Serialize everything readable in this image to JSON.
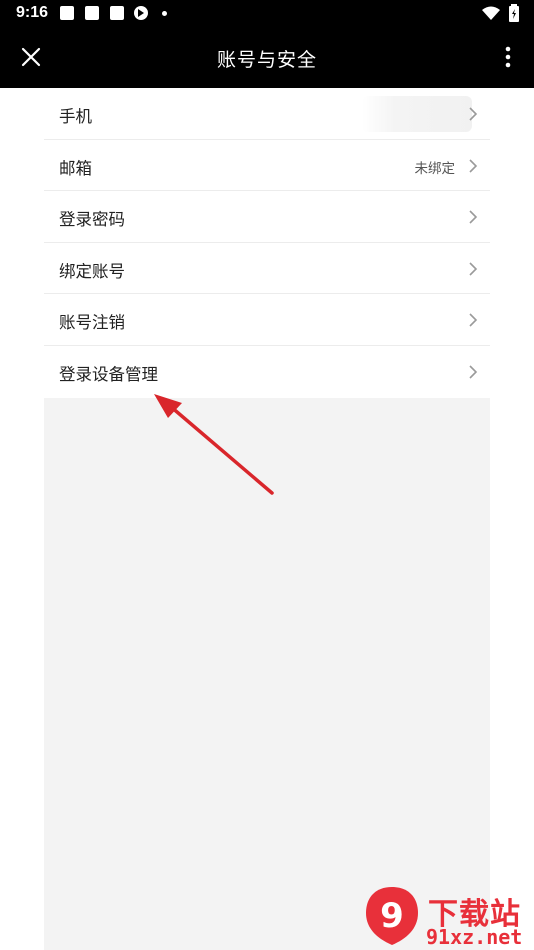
{
  "status_bar": {
    "time": "9:16"
  },
  "header": {
    "title": "账号与安全",
    "close_icon": "close-icon",
    "more_icon": "more-vertical-icon"
  },
  "settings": {
    "items": [
      {
        "label": "手机",
        "value": ""
      },
      {
        "label": "邮箱",
        "value": "未绑定"
      },
      {
        "label": "登录密码",
        "value": ""
      },
      {
        "label": "绑定账号",
        "value": ""
      },
      {
        "label": "账号注销",
        "value": ""
      },
      {
        "label": "登录设备管理",
        "value": ""
      }
    ]
  },
  "watermark": {
    "brand": "下载站",
    "url": "91xz.net",
    "logo_text": "9"
  },
  "colors": {
    "bar_bg": "#000000",
    "content_bg": "#f3f3f3",
    "arrow": "#d9262b",
    "watermark": "#e8303a"
  }
}
